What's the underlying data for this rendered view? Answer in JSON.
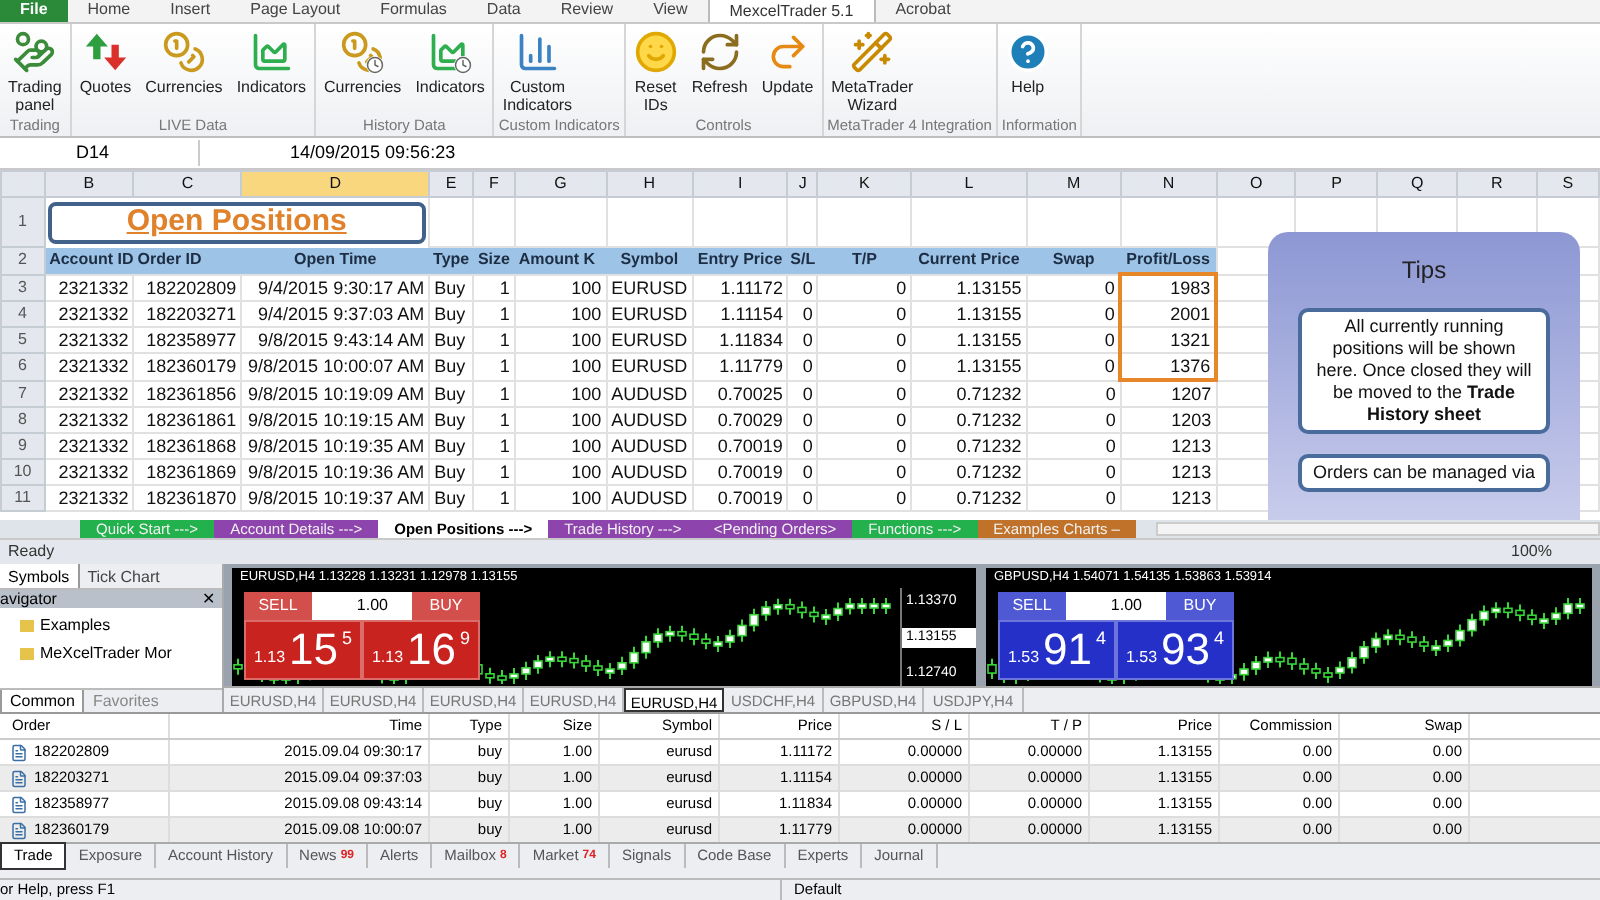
{
  "ribbon": {
    "tabs": [
      {
        "label": "File",
        "selected": false,
        "kind": "file"
      },
      {
        "label": "Home",
        "selected": false,
        "kind": "tab"
      },
      {
        "label": "Insert",
        "selected": false,
        "kind": "tab"
      },
      {
        "label": "Page Layout",
        "selected": false,
        "kind": "tab"
      },
      {
        "label": "Formulas",
        "selected": false,
        "kind": "tab"
      },
      {
        "label": "Data",
        "selected": false,
        "kind": "tab"
      },
      {
        "label": "Review",
        "selected": false,
        "kind": "tab"
      },
      {
        "label": "View",
        "selected": false,
        "kind": "tab"
      },
      {
        "label": "MexcelTrader 5.1",
        "selected": true,
        "kind": "tab"
      },
      {
        "label": "Acrobat",
        "selected": false,
        "kind": "tab"
      }
    ],
    "groups": [
      {
        "name": "Trading",
        "buttons": [
          "Trading\npanel"
        ]
      },
      {
        "name": "LIVE Data",
        "buttons": [
          "Quotes",
          "Currencies",
          "Indicators"
        ]
      },
      {
        "name": "History Data",
        "buttons": [
          "Currencies",
          "Indicators"
        ]
      },
      {
        "name": "Custom Indicators",
        "buttons": [
          "Custom\nIndicators"
        ]
      },
      {
        "name": "Controls",
        "buttons": [
          "Reset\nIDs",
          "Refresh",
          "Update"
        ]
      },
      {
        "name": "MetaTrader 4 Integration",
        "buttons": [
          "MetaTrader\nWizard"
        ]
      },
      {
        "name": "Information",
        "buttons": [
          "Help"
        ]
      }
    ]
  },
  "formula_bar": {
    "cell": "D14",
    "value": "14/09/2015  09:56:23"
  },
  "columns": [
    {
      "label": "B",
      "selected": false
    },
    {
      "label": "C",
      "selected": false
    },
    {
      "label": "D",
      "selected": true
    },
    {
      "label": "E",
      "selected": false
    },
    {
      "label": "F",
      "selected": false
    },
    {
      "label": "G",
      "selected": false
    },
    {
      "label": "H",
      "selected": false
    },
    {
      "label": "I",
      "selected": false
    },
    {
      "label": "J",
      "selected": false
    },
    {
      "label": "K",
      "selected": false
    },
    {
      "label": "L",
      "selected": false
    },
    {
      "label": "M",
      "selected": false
    },
    {
      "label": "N",
      "selected": false
    },
    {
      "label": "O",
      "selected": false
    },
    {
      "label": "P",
      "selected": false
    },
    {
      "label": "Q",
      "selected": false
    },
    {
      "label": "R",
      "selected": false
    },
    {
      "label": "S",
      "selected": false
    }
  ],
  "sheet": {
    "title_row": "1",
    "title": "Open Positions",
    "header_row": "2",
    "headers": [
      "Account ID",
      "Order ID",
      "Open Time",
      "Type",
      "Size",
      "Amount K",
      "Symbol",
      "Entry Price",
      "S/L",
      "T/P",
      "Current Price",
      "Swap",
      "Profit/Loss"
    ],
    "rows": [
      {
        "number": "3",
        "flagged": true,
        "cells": [
          "2321332",
          "182202809",
          "9/4/2015 9:30:17 AM",
          "Buy",
          "1",
          "100",
          "EURUSD",
          "1.11172",
          "0",
          "0",
          "1.13155",
          "0",
          "1983"
        ]
      },
      {
        "number": "4",
        "flagged": true,
        "cells": [
          "2321332",
          "182203271",
          "9/4/2015 9:37:03 AM",
          "Buy",
          "1",
          "100",
          "EURUSD",
          "1.11154",
          "0",
          "0",
          "1.13155",
          "0",
          "2001"
        ]
      },
      {
        "number": "5",
        "flagged": true,
        "cells": [
          "2321332",
          "182358977",
          "9/8/2015 9:43:14 AM",
          "Buy",
          "1",
          "100",
          "EURUSD",
          "1.11834",
          "0",
          "0",
          "1.13155",
          "0",
          "1321"
        ]
      },
      {
        "number": "6",
        "flagged": true,
        "cells": [
          "2321332",
          "182360179",
          "9/8/2015 10:00:07 AM",
          "Buy",
          "1",
          "100",
          "EURUSD",
          "1.11779",
          "0",
          "0",
          "1.13155",
          "0",
          "1376"
        ]
      },
      {
        "number": "7",
        "flagged": false,
        "cells": [
          "2321332",
          "182361856",
          "9/8/2015 10:19:09 AM",
          "Buy",
          "1",
          "100",
          "AUDUSD",
          "0.70025",
          "0",
          "0",
          "0.71232",
          "0",
          "1207"
        ]
      },
      {
        "number": "8",
        "flagged": false,
        "cells": [
          "2321332",
          "182361861",
          "9/8/2015 10:19:15 AM",
          "Buy",
          "1",
          "100",
          "AUDUSD",
          "0.70029",
          "0",
          "0",
          "0.71232",
          "0",
          "1203"
        ]
      },
      {
        "number": "9",
        "flagged": false,
        "cells": [
          "2321332",
          "182361868",
          "9/8/2015 10:19:35 AM",
          "Buy",
          "1",
          "100",
          "AUDUSD",
          "0.70019",
          "0",
          "0",
          "0.71232",
          "0",
          "1213"
        ]
      },
      {
        "number": "10",
        "flagged": false,
        "cells": [
          "2321332",
          "182361869",
          "9/8/2015 10:19:36 AM",
          "Buy",
          "1",
          "100",
          "AUDUSD",
          "0.70019",
          "0",
          "0",
          "0.71232",
          "0",
          "1213"
        ]
      },
      {
        "number": "11",
        "flagged": false,
        "cells": [
          "2321332",
          "182361870",
          "9/8/2015 10:19:37 AM",
          "Buy",
          "1",
          "100",
          "AUDUSD",
          "0.70019",
          "0",
          "0",
          "0.71232",
          "0",
          "1213"
        ]
      }
    ]
  },
  "tips": {
    "title": "Tips",
    "notes": [
      "All currently running positions will be shown here.  Once closed they will be moved to the **Trade History sheet**",
      "Orders can be managed via"
    ]
  },
  "sheet_tabs": [
    {
      "label": "Quick Start --->",
      "selected": false,
      "color": "#22b14c"
    },
    {
      "label": "Account Details --->",
      "selected": false,
      "color": "#8e44ad"
    },
    {
      "label": "Open Positions --->",
      "selected": true,
      "color": "#ffffff"
    },
    {
      "label": "Trade History --->",
      "selected": false,
      "color": "#8e44ad"
    },
    {
      "label": "<Pending Orders>",
      "selected": false,
      "color": "#8e44ad"
    },
    {
      "label": "Functions --->",
      "selected": false,
      "color": "#22b14c"
    },
    {
      "label": "Examples Charts –",
      "selected": false,
      "color": "#c0722a"
    }
  ],
  "status_bar": {
    "text": "Ready",
    "zoom": "100%"
  },
  "terminal": {
    "side_tabs": [
      {
        "label": "Symbols",
        "selected": true
      },
      {
        "label": "Tick Chart",
        "selected": false
      }
    ],
    "navigator": {
      "title": "avigator",
      "close": "✕",
      "items": [
        "Examples",
        "MeXcelTrader Mor"
      ]
    },
    "bottom_side_tabs": [
      {
        "label": "Common",
        "selected": true
      },
      {
        "label": "Favorites",
        "selected": false
      }
    ],
    "charts": [
      {
        "title": "EURUSD,H4  1.13228 1.13231 1.12978 1.13155",
        "color": "#c8231f",
        "sell": "SELL",
        "buy": "BUY",
        "lots": "1.00",
        "sell_price": [
          "1.13",
          "15",
          "5"
        ],
        "buy_price": [
          "1.13",
          "16",
          "9"
        ],
        "axis": [
          "1.13370",
          "1.13155",
          "1.12740"
        ]
      },
      {
        "title": "GBPUSD,H4  1.54071 1.54135 1.53863 1.53914",
        "color": "#2430c8",
        "sell": "SELL",
        "buy": "BUY",
        "lots": "1.00",
        "sell_price": [
          "1.53",
          "91",
          "4"
        ],
        "buy_price": [
          "1.53",
          "93",
          "4"
        ]
      }
    ],
    "chart_tabs": [
      {
        "label": "EURUSD,H4",
        "selected": false
      },
      {
        "label": "EURUSD,H4",
        "selected": false
      },
      {
        "label": "EURUSD,H4",
        "selected": false
      },
      {
        "label": "EURUSD,H4",
        "selected": false
      },
      {
        "label": "EURUSD,H4",
        "selected": true
      },
      {
        "label": "USDCHF,H4",
        "selected": false
      },
      {
        "label": "GBPUSD,H4",
        "selected": false
      },
      {
        "label": "USDJPY,H4",
        "selected": false
      }
    ],
    "orders": {
      "columns": [
        "Order",
        "Time",
        "Type",
        "Size",
        "Symbol",
        "Price",
        "S / L",
        "T / P",
        "Price",
        "Commission",
        "Swap"
      ],
      "rows": [
        [
          "182202809",
          "2015.09.04 09:30:17",
          "buy",
          "1.00",
          "eurusd",
          "1.11172",
          "0.00000",
          "0.00000",
          "1.13155",
          "0.00",
          "0.00"
        ],
        [
          "182203271",
          "2015.09.04 09:37:03",
          "buy",
          "1.00",
          "eurusd",
          "1.11154",
          "0.00000",
          "0.00000",
          "1.13155",
          "0.00",
          "0.00"
        ],
        [
          "182358977",
          "2015.09.08 09:43:14",
          "buy",
          "1.00",
          "eurusd",
          "1.11834",
          "0.00000",
          "0.00000",
          "1.13155",
          "0.00",
          "0.00"
        ],
        [
          "182360179",
          "2015.09.08 10:00:07",
          "buy",
          "1.00",
          "eurusd",
          "1.11779",
          "0.00000",
          "0.00000",
          "1.13155",
          "0.00",
          "0.00"
        ]
      ]
    },
    "terminal_tabs": [
      {
        "label": "Trade",
        "selected": true
      },
      {
        "label": "Exposure",
        "selected": false
      },
      {
        "label": "Account History",
        "selected": false
      },
      {
        "label": "News",
        "selected": false,
        "badge": "99"
      },
      {
        "label": "Alerts",
        "selected": false
      },
      {
        "label": "Mailbox",
        "selected": false,
        "badge": "8"
      },
      {
        "label": "Market",
        "selected": false,
        "badge": "74"
      },
      {
        "label": "Signals",
        "selected": false
      },
      {
        "label": "Code Base",
        "selected": false
      },
      {
        "label": "Experts",
        "selected": false
      },
      {
        "label": "Journal",
        "selected": false
      }
    ],
    "footer": {
      "help": "or Help, press F1",
      "profile": "Default"
    }
  }
}
